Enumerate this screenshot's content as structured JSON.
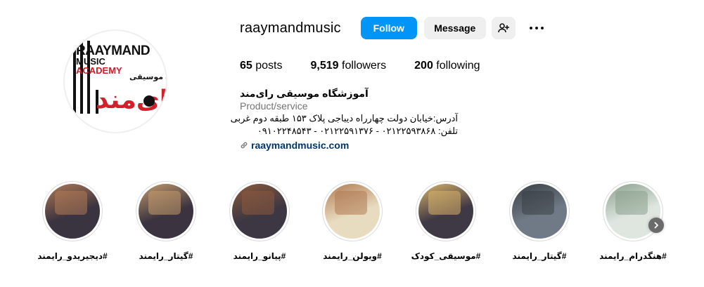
{
  "profile": {
    "username": "raaymandmusic",
    "logo_text": {
      "en_line1": "RAAYMAND",
      "en_line2": "MUSIC",
      "en_line3": "ACADEMY",
      "fa_small": "آموزشگاه موسیقی",
      "fa_big": "رای‌مند"
    }
  },
  "actions": {
    "follow_label": "Follow",
    "message_label": "Message",
    "add_user_icon": "add-user-icon",
    "more_icon": "more-options-icon"
  },
  "stats": {
    "posts_count": "65",
    "posts_label": "posts",
    "followers_count": "9,519",
    "followers_label": "followers",
    "following_count": "200",
    "following_label": "following"
  },
  "bio": {
    "name": "آموزشگاه موسیقی رای‌مند",
    "category": "Product/service",
    "address": "آدرس:خیابان دولت چهارراه دیباجی پلاک ۱۵۳ طبقه دوم غربی",
    "phones": "تلفن: ۰۲۱۲۲۵۹۳۸۶۸ - ۰۲۱۲۲۵۹۱۳۷۶ - ۰۹۱۰۲۲۴۸۵۴۳",
    "link": "raaymandmusic.com"
  },
  "highlights": [
    {
      "label": "#دیجیریدو_رایمند",
      "bg": "#3a3340",
      "accent": "#b07a55"
    },
    {
      "label": "#گیتار_رایمند",
      "bg": "#3b3440",
      "accent": "#c49a6c"
    },
    {
      "label": "#پیانو_رایمند",
      "bg": "#3d3743",
      "accent": "#8b5a3c"
    },
    {
      "label": "#ویولن_رایمند",
      "bg": "#e8dcc0",
      "accent": "#b07a52"
    },
    {
      "label": "#موسیقی_کودک",
      "bg": "#3f3845",
      "accent": "#d8b36a"
    },
    {
      "label": "#گیتار_رایمند",
      "bg": "#6f7a86",
      "accent": "#3a3f45"
    },
    {
      "label": "#هنگدرام_رایمند",
      "bg": "#dfe6e0",
      "accent": "#8aa08c"
    }
  ],
  "colors": {
    "follow_blue": "#0095f6",
    "secondary_button": "#efefef",
    "link_blue": "#00376b",
    "muted_text": "#737373",
    "logo_red": "#d4202b"
  }
}
